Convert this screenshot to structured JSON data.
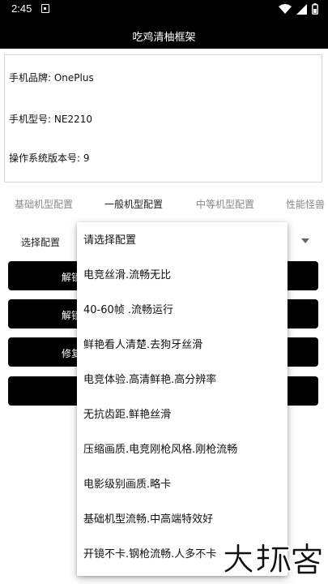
{
  "status_bar": {
    "time": "2:45",
    "icons": [
      "notification-icon",
      "wifi-icon",
      "signal-icon",
      "battery-icon"
    ]
  },
  "app_bar": {
    "title": "吃鸡清柚框架"
  },
  "device_info": {
    "brand_label": "手机品牌: ",
    "brand_value": "OnePlus",
    "model_label": "手机型号: ",
    "model_value": "NE2210",
    "os_label": "操作系统版本号: ",
    "os_value": "9"
  },
  "tabs": [
    {
      "label": "基础机型配置",
      "active": false
    },
    {
      "label": "一般机型配置",
      "active": true
    },
    {
      "label": "中等机型配置",
      "active": false
    },
    {
      "label": "性能怪兽",
      "active": false
    }
  ],
  "config": {
    "label": "选择配置"
  },
  "buttons": [
    {
      "label": "解锁"
    },
    {
      "label": "解锁"
    },
    {
      "label": "修复"
    },
    {
      "label": ""
    }
  ],
  "dropdown": {
    "options": [
      "请选择配置",
      "电竞丝滑.流畅无比",
      "40-60帧  .流畅运行",
      "鲜艳看人清楚.去狗牙丝滑",
      "电竞体验.高清鲜艳.高分辨率",
      "无抗齿距.鲜艳丝滑",
      "压缩画质.电竞刚枪风格.刚枪流畅",
      "电影级别画质.略卡",
      "基础机型流畅.中高端特效好",
      "开镜不卡.钢枪流畅.人多不卡"
    ]
  },
  "colors": {
    "bar": "#000000",
    "tab_active": "#222222",
    "tab_inactive": "#888888"
  }
}
